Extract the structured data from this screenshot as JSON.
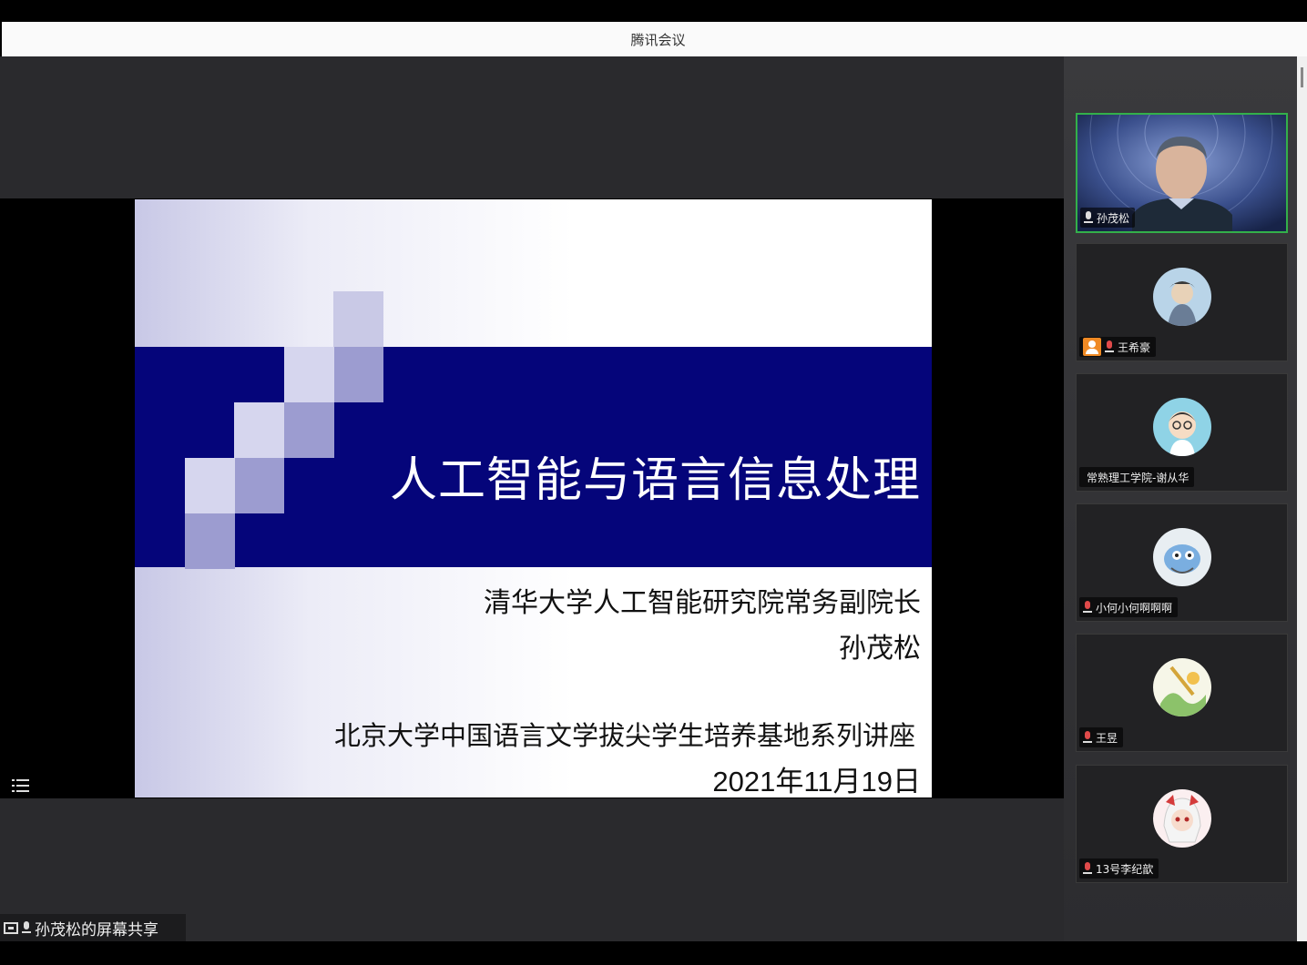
{
  "window": {
    "title": "腾讯会议"
  },
  "slide": {
    "title": "人工智能与语言信息处理",
    "affiliation": "清华大学人工智能研究院常务副院长",
    "speaker": "孙茂松",
    "series": "北京大学中国语言文学拔尖学生培养基地系列讲座",
    "date": "2021年11月19日",
    "colors": {
      "band": "#05057a",
      "square_light": "#c9c9e6",
      "square_mid": "#9c9cd0"
    }
  },
  "participants": [
    {
      "name": "孙茂松",
      "role": "speaker-video",
      "mic": "on"
    },
    {
      "name": "王希豪",
      "mic": "muted",
      "host_badge": true
    },
    {
      "name": "常熟理工学院-谢从华",
      "mic": "none"
    },
    {
      "name": "小何小何啊啊啊",
      "mic": "muted"
    },
    {
      "name": "王昱",
      "mic": "muted"
    },
    {
      "name": "13号李纪歆",
      "mic": "muted"
    }
  ],
  "share_status": {
    "label": "孙茂松的屏幕共享"
  },
  "icons": [
    "mic-icon",
    "muted-mic-icon",
    "screen-share-icon",
    "list-icon",
    "host-badge-icon"
  ]
}
